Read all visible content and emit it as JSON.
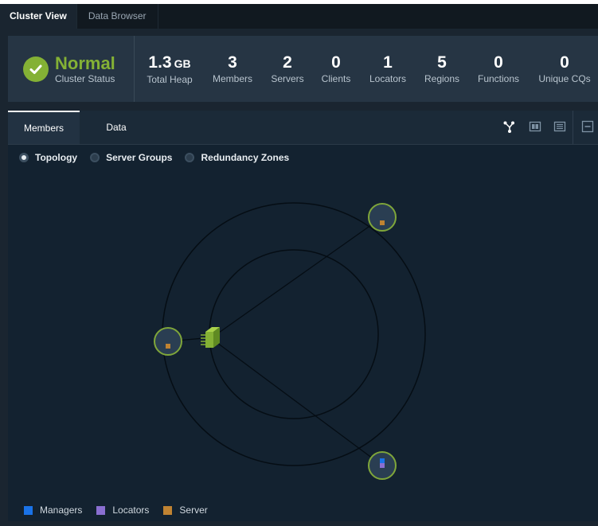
{
  "tabs": [
    {
      "label": "Cluster View",
      "active": true
    },
    {
      "label": "Data Browser",
      "active": false
    }
  ],
  "cluster": {
    "status_word": "Normal",
    "status_label": "Cluster Status",
    "status_color": "#84b135"
  },
  "metrics": [
    {
      "value": "1.3",
      "unit": "GB",
      "label": "Total Heap"
    },
    {
      "value": "3",
      "unit": "",
      "label": "Members"
    },
    {
      "value": "2",
      "unit": "",
      "label": "Servers"
    },
    {
      "value": "0",
      "unit": "",
      "label": "Clients"
    },
    {
      "value": "1",
      "unit": "",
      "label": "Locators"
    },
    {
      "value": "5",
      "unit": "",
      "label": "Regions"
    },
    {
      "value": "0",
      "unit": "",
      "label": "Functions"
    },
    {
      "value": "0",
      "unit": "",
      "label": "Unique CQs"
    }
  ],
  "members_tabs": [
    {
      "label": "Members",
      "active": true
    },
    {
      "label": "Data",
      "active": false
    }
  ],
  "toolbar_icons": [
    "topology-icon",
    "grid-view-icon",
    "table-view-icon",
    "collapse-icon"
  ],
  "view_modes": [
    {
      "label": "Topology",
      "selected": true
    },
    {
      "label": "Server Groups",
      "selected": false
    },
    {
      "label": "Redundancy Zones",
      "selected": false
    }
  ],
  "legend": [
    {
      "label": "Managers",
      "color": "#1a73e8"
    },
    {
      "label": "Locators",
      "color": "#8a6fd1"
    },
    {
      "label": "Server",
      "color": "#c08332"
    }
  ],
  "colors": {
    "accent_green": "#84b135",
    "node_ring": "#7fa63a",
    "orbit": "#050d14"
  }
}
